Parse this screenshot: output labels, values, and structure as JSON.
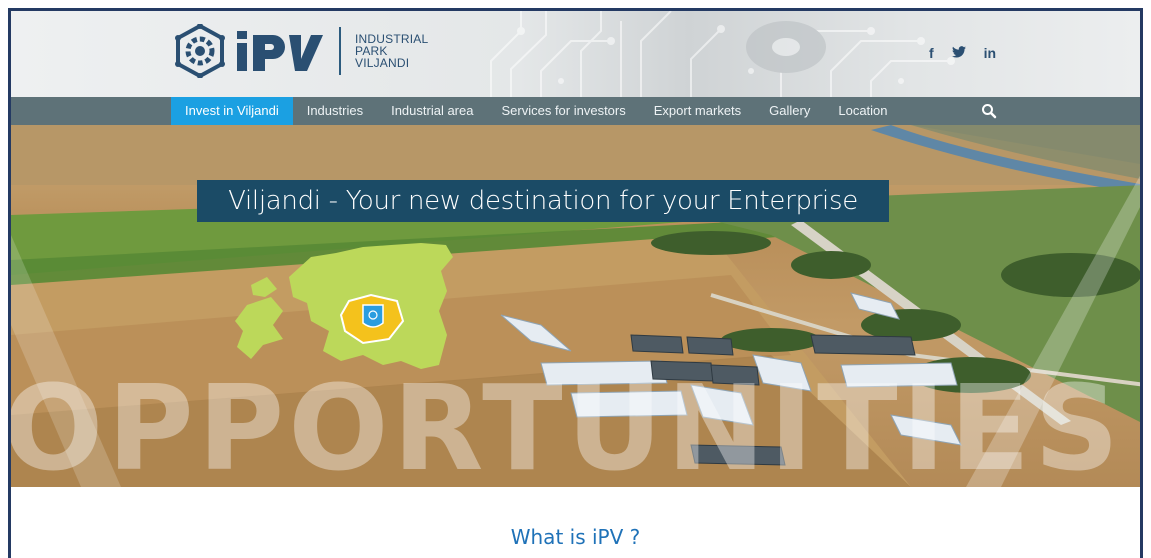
{
  "header": {
    "logo_text": "iPV",
    "logo_lines": [
      "INDUSTRIAL",
      "PARK",
      "VILJANDI"
    ],
    "social": [
      {
        "icon": "facebook-icon",
        "label": "f"
      },
      {
        "icon": "twitter-icon",
        "label": "🐦"
      },
      {
        "icon": "linkedin-icon",
        "label": "in"
      }
    ]
  },
  "nav": {
    "items": [
      {
        "label": "Invest in Viljandi",
        "active": true
      },
      {
        "label": "Industries"
      },
      {
        "label": "Industrial area"
      },
      {
        "label": "Services for investors"
      },
      {
        "label": "Export markets"
      },
      {
        "label": "Gallery"
      },
      {
        "label": "Location"
      }
    ],
    "search_icon": "search-icon"
  },
  "hero": {
    "headline": "Viljandi - Your new destination for your Enterprise",
    "overlay_word": "OPPORTUNITIES"
  },
  "content": {
    "heading": "What is iPV ?"
  },
  "colors": {
    "brand": "#2a4f72",
    "nav_bg": "#5e7278",
    "nav_active": "#1ba0e2",
    "headline_bg": "#1b4b66",
    "heading": "#1f72b8",
    "frame": "#243a63"
  }
}
